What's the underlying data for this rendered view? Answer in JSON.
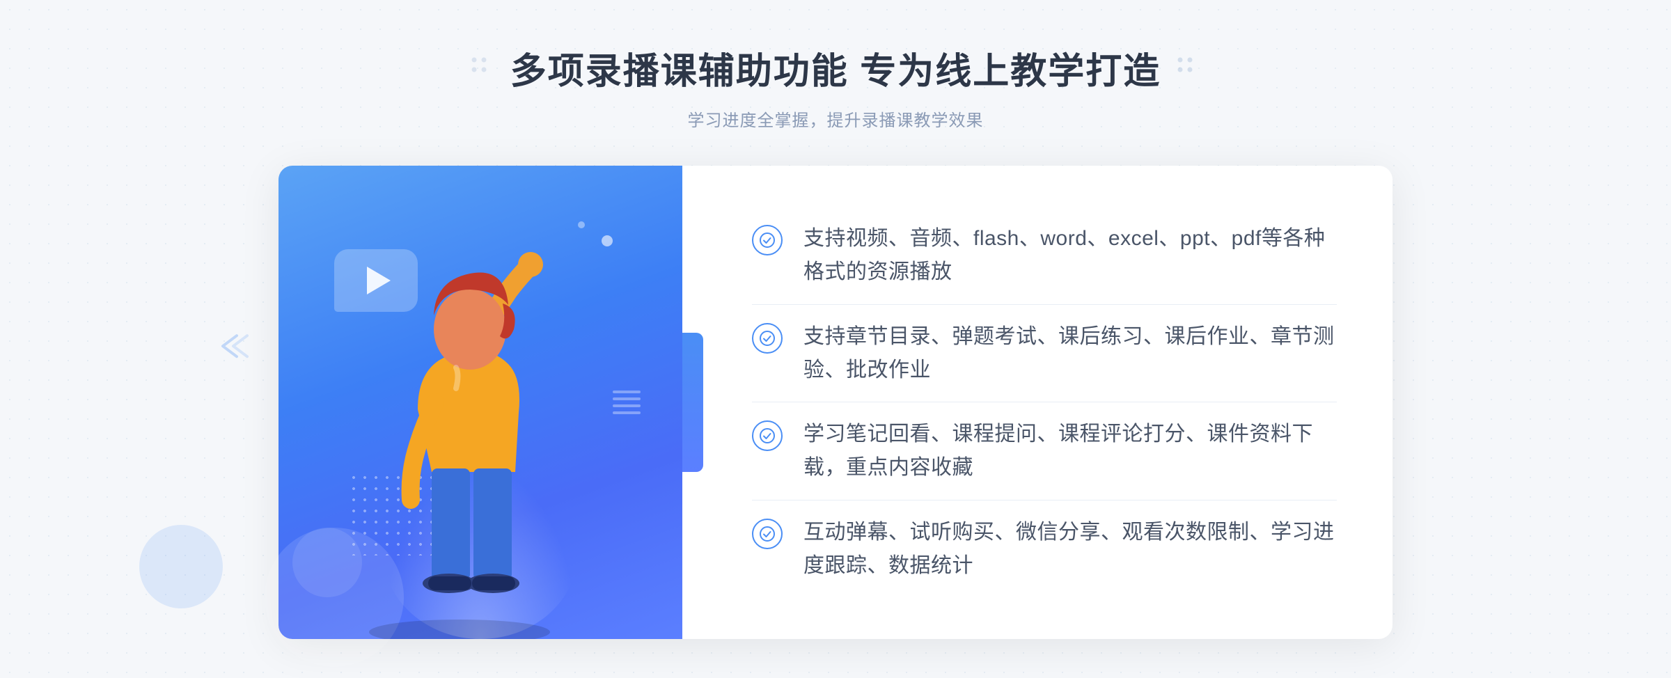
{
  "header": {
    "title": "多项录播课辅助功能 专为线上教学打造",
    "subtitle": "学习进度全掌握，提升录播课教学效果"
  },
  "features": [
    {
      "id": "feature-1",
      "text": "支持视频、音频、flash、word、excel、ppt、pdf等各种格式的资源播放"
    },
    {
      "id": "feature-2",
      "text": "支持章节目录、弹题考试、课后练习、课后作业、章节测验、批改作业"
    },
    {
      "id": "feature-3",
      "text": "学习笔记回看、课程提问、课程评论打分、课件资料下载，重点内容收藏"
    },
    {
      "id": "feature-4",
      "text": "互动弹幕、试听购买、微信分享、观看次数限制、学习进度跟踪、数据统计"
    }
  ],
  "icons": {
    "check": "check-circle-icon",
    "play": "play-icon",
    "dots_left": "dots-decoration-left",
    "dots_right": "dots-decoration-right",
    "chevrons": "chevrons-icon"
  },
  "colors": {
    "primary": "#4a8ef5",
    "title": "#2d3748",
    "subtitle": "#8a9ab5",
    "feature_text": "#4a5568",
    "background": "#f5f7fa",
    "card_bg": "#ffffff",
    "illustration_gradient_start": "#5ba3f5",
    "illustration_gradient_end": "#5b7fff"
  }
}
